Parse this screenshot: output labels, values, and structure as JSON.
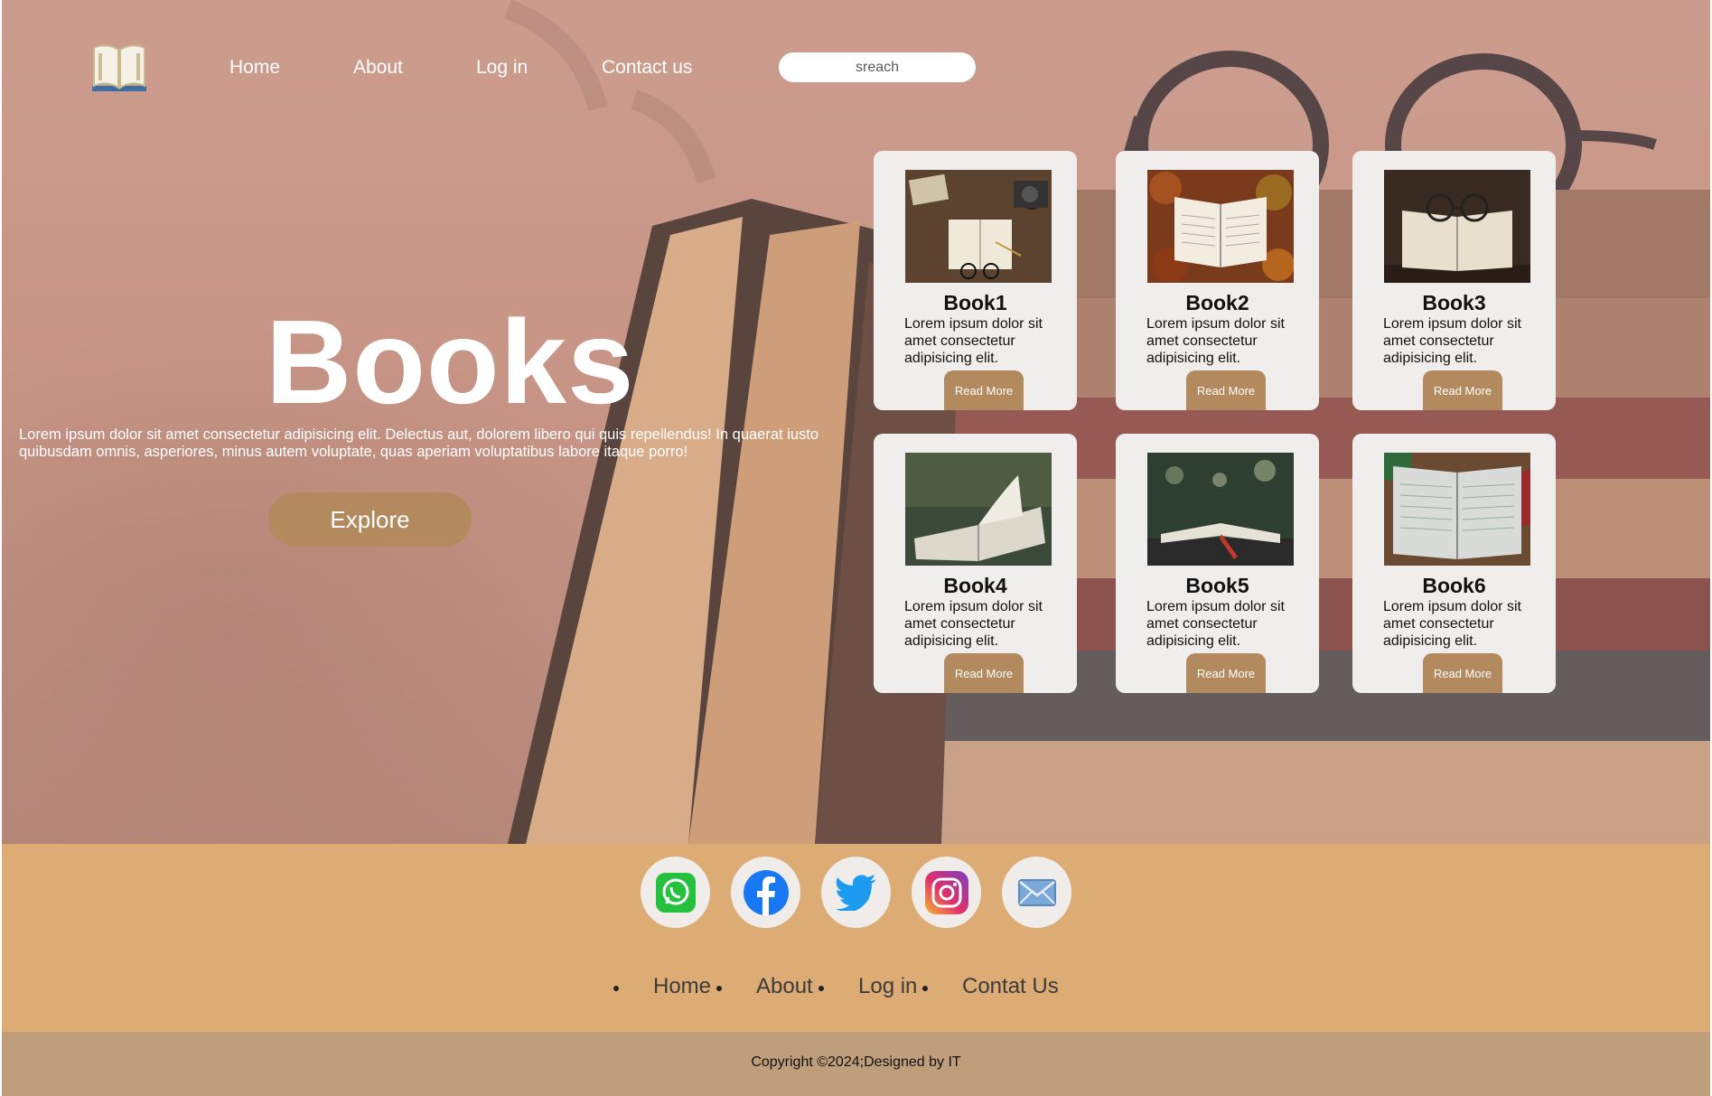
{
  "nav": {
    "logo_icon": "open-book-icon",
    "links": [
      "Home",
      "About",
      "Log in",
      "Contact us"
    ],
    "search_placeholder": "sreach"
  },
  "hero": {
    "title": "Books",
    "text": "Lorem ipsum dolor sit amet consectetur adipisicing elit. Delectus aut, dolorem libero qui quis repellendus! In quaerat iusto quibusdam omnis, asperiores, minus autem voluptate, quas aperiam voluptatibus labore itaque porro!",
    "button": "Explore"
  },
  "books": [
    {
      "title": "Book1",
      "desc": "Lorem ipsum dolor sit amet consectetur adipisicing elit.",
      "button": "Read More"
    },
    {
      "title": "Book2",
      "desc": "Lorem ipsum dolor sit amet consectetur adipisicing elit.",
      "button": "Read More"
    },
    {
      "title": "Book3",
      "desc": "Lorem ipsum dolor sit amet consectetur adipisicing elit.",
      "button": "Read More"
    },
    {
      "title": "Book4",
      "desc": "Lorem ipsum dolor sit amet consectetur adipisicing elit.",
      "button": "Read More"
    },
    {
      "title": "Book5",
      "desc": "Lorem ipsum dolor sit amet consectetur adipisicing elit.",
      "button": "Read More"
    },
    {
      "title": "Book6",
      "desc": "Lorem ipsum dolor sit amet consectetur adipisicing elit.",
      "button": "Read More"
    }
  ],
  "social": [
    "whatsapp-icon",
    "facebook-icon",
    "twitter-icon",
    "instagram-icon",
    "mail-icon"
  ],
  "footer": {
    "links": [
      "Home",
      "About",
      "Log in",
      "Contat Us"
    ],
    "copyright": "Copyright ©2024;Designed by IT"
  },
  "colors": {
    "accent": "#b38a5e",
    "footer_top": "#ddac75",
    "footer_bottom": "#bf9e7c",
    "card_bg": "#f0eeed"
  }
}
